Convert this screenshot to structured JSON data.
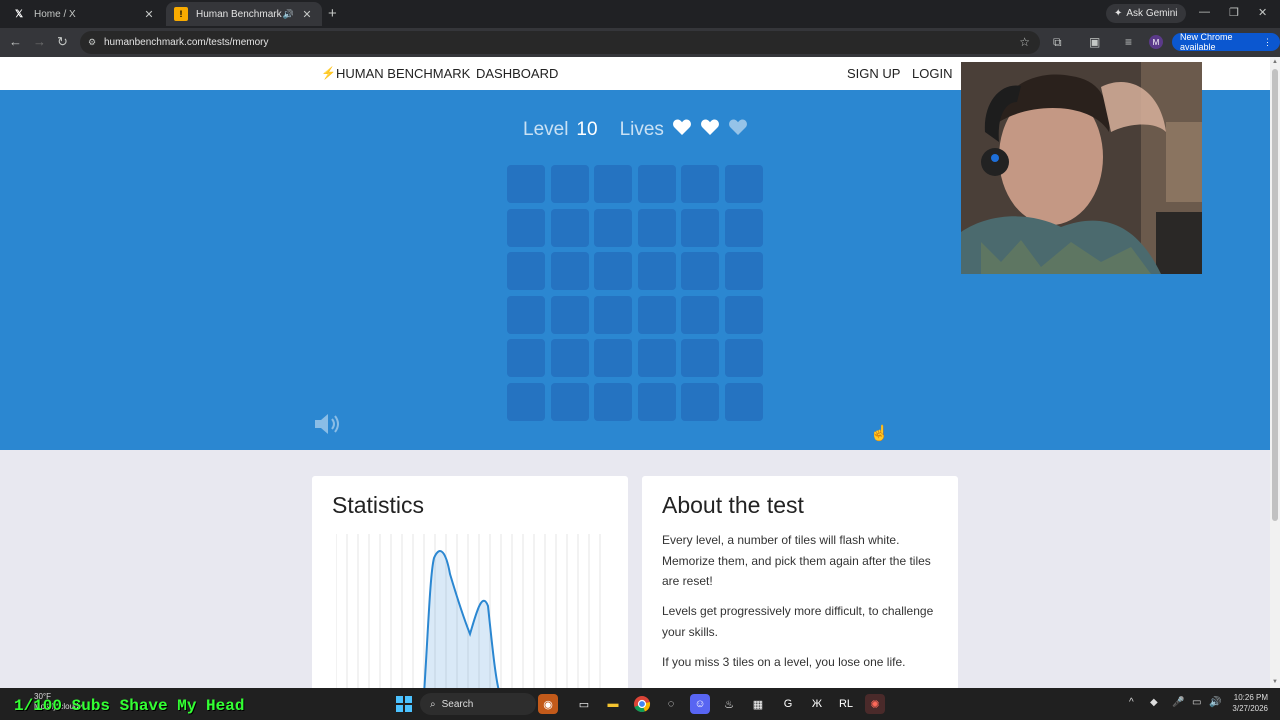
{
  "browser": {
    "tabs": [
      {
        "title": "Home / X",
        "icon": "x-logo-icon"
      },
      {
        "title": "Human Benchmark - Visual",
        "icon": "benchmark-favicon",
        "audio": true
      }
    ],
    "ask_gemini": "Ask Gemini",
    "url": "humanbenchmark.com/tests/memory",
    "new_chrome": "New Chrome available",
    "profile_initial": "M"
  },
  "site_nav": {
    "brand": "HUMAN BENCHMARK",
    "dashboard": "DASHBOARD",
    "signup": "SIGN UP",
    "login": "LOGIN"
  },
  "game": {
    "level_label": "Level",
    "level": "10",
    "lives_label": "Lives",
    "lives_total": 3,
    "lives_remaining": 2,
    "grid_rows": 6,
    "grid_cols": 6,
    "colors": {
      "hero": "#2b87d1",
      "tile": "#2573c1"
    }
  },
  "statistics": {
    "title": "Statistics"
  },
  "about": {
    "title": "About the test",
    "p1": "Every level, a number of tiles will flash white. Memorize them, and pick them again after the tiles are reset!",
    "p2": "Levels get progressively more difficult, to challenge your skills.",
    "p3": "If you miss 3 tiles on a level, you lose one life."
  },
  "taskbar": {
    "weather_temp": "30°F",
    "weather_desc": "Mostly cloudy",
    "overlay": "1/100 Subs Shave My Head",
    "search": "Search",
    "time": "10:26 PM",
    "date": "3/27/2026"
  }
}
